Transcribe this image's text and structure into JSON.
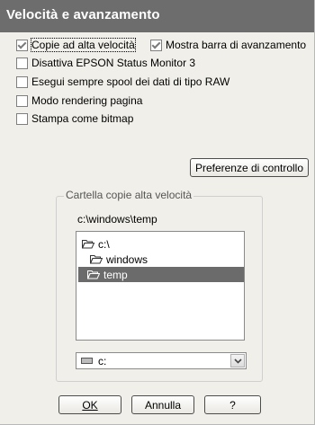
{
  "window": {
    "title": "Velocità e avanzamento"
  },
  "options": [
    {
      "label": "Copie ad alta velocità",
      "checked": true
    },
    {
      "label": "Mostra barra di avanzamento",
      "checked": true
    },
    {
      "label": "Disattiva EPSON Status Monitor 3",
      "checked": false
    },
    {
      "label": "Esegui sempre spool dei dati di tipo RAW",
      "checked": false
    },
    {
      "label": "Modo rendering pagina",
      "checked": false
    },
    {
      "label": "Stampa come bitmap",
      "checked": false
    }
  ],
  "preferences_button": "Preferenze di controllo",
  "folder_group": {
    "legend": "Cartella copie alta velocità",
    "current_path": "c:\\windows\\temp",
    "tree": [
      {
        "label": "c:\\",
        "level": 0,
        "selected": false
      },
      {
        "label": "windows",
        "level": 1,
        "selected": false
      },
      {
        "label": "temp",
        "level": 2,
        "selected": true
      }
    ],
    "drive": {
      "value": "c:",
      "icon": "drive-icon"
    }
  },
  "buttons": {
    "ok": "OK",
    "cancel": "Annulla",
    "help": "?"
  },
  "colors": {
    "titlebar": "#6d6d6d",
    "selection": "#6b6b6b",
    "dialog_bg": "#f0efe9"
  }
}
